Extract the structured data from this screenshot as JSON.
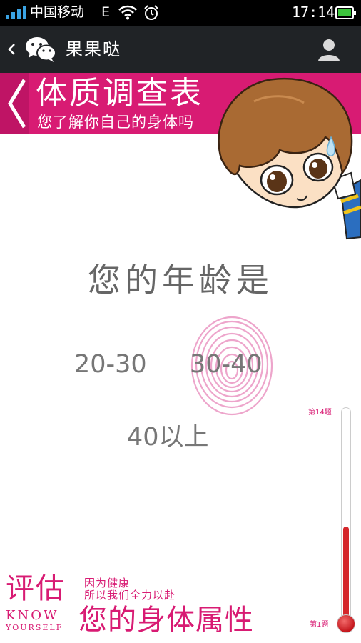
{
  "status_bar": {
    "carrier": "中国移动",
    "network": "E",
    "time": "17:14",
    "icons": [
      "signal-icon",
      "wifi-icon",
      "alarm-icon",
      "battery-icon"
    ]
  },
  "title_bar": {
    "title": "果果哒",
    "icons": [
      "back-icon",
      "wechat-icon",
      "user-profile-icon"
    ]
  },
  "banner": {
    "title": "体质调查表",
    "subtitle": "您了解你自己的身体吗"
  },
  "question": {
    "text": "您的年龄是",
    "options": [
      "20-30",
      "30-40",
      "40以上"
    ]
  },
  "progress": {
    "top_label": "第14题",
    "bottom_label": "第1题",
    "fill_fraction": 0.44
  },
  "footer": {
    "big": "评估",
    "small_line1": "因为健康",
    "small_line2": "所以我们全力以赴",
    "know": "KNOW",
    "yourself": "YOURSELF",
    "attribute": "您的身体属性"
  },
  "colors": {
    "accent": "#d81b73",
    "progress_fill": "#d4262b",
    "titlebar": "#202326"
  }
}
